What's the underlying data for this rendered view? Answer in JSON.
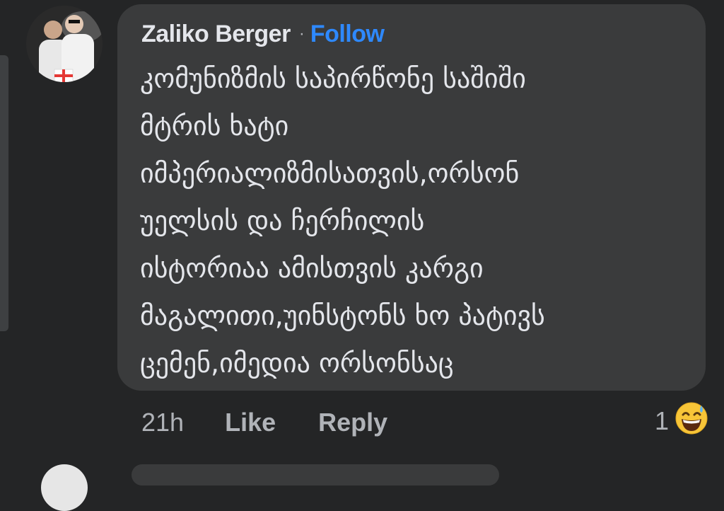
{
  "comment": {
    "author": "Zaliko Berger",
    "separator": "·",
    "follow_label": "Follow",
    "lines": [
      "კომუნიზმის საპირწონე საშიში",
      "მტრის ხატი",
      "იმპერიალიზმისათვის,ორსონ",
      "უელსის და ჩერჩილის",
      "ისტორიაა ამისთვის კარგი",
      "მაგალითი,უინსტონს ხო პატივს",
      "ცემენ,იმედია ორსონსაც"
    ],
    "timestamp": "21h",
    "like_label": "Like",
    "reply_label": "Reply",
    "reaction_count": "1",
    "reaction_icon": "grinning-sweat-emoji"
  },
  "colors": {
    "background": "#242526",
    "bubble": "#3a3b3c",
    "text": "#e4e6eb",
    "muted": "#b0b3b8",
    "follow": "#2e89ff"
  }
}
